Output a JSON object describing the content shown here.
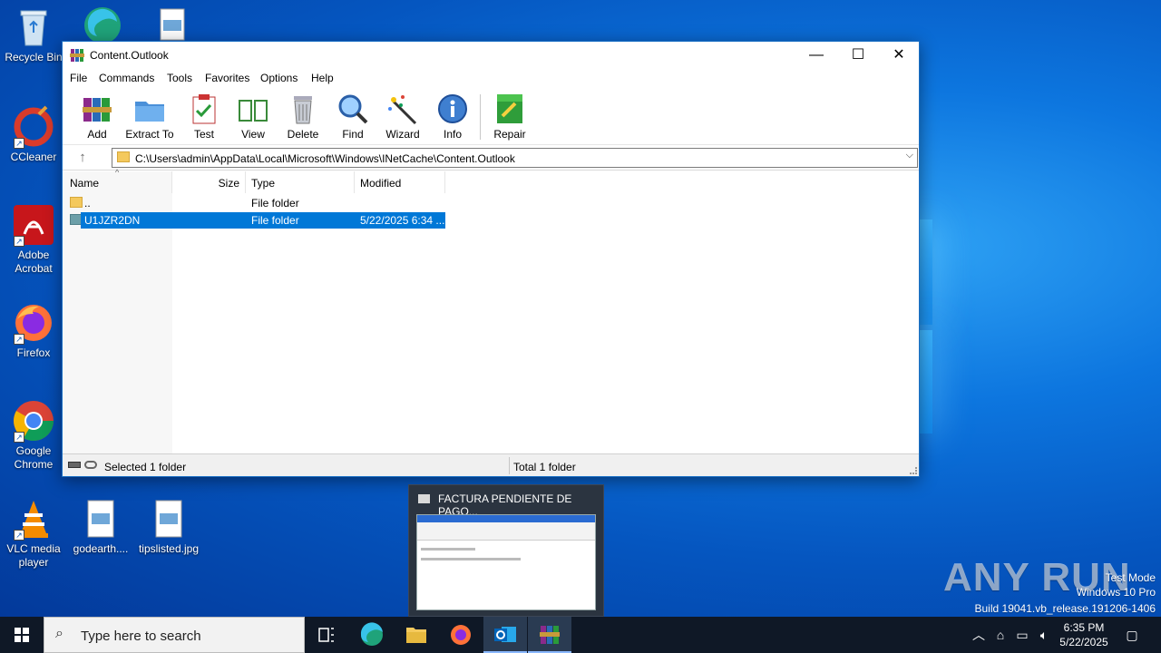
{
  "desktop": {
    "icons": [
      {
        "label": "Recycle Bin",
        "icon": "recycle-bin-icon"
      },
      {
        "label": "CCleaner",
        "icon": "ccleaner-icon"
      },
      {
        "label": "Adobe Acrobat",
        "icon": "adobe-acrobat-icon"
      },
      {
        "label": "Firefox",
        "icon": "firefox-icon"
      },
      {
        "label": "Google Chrome",
        "icon": "chrome-icon"
      },
      {
        "label": "VLC media player",
        "icon": "vlc-icon"
      },
      {
        "label": "godearth....",
        "icon": "image-file-icon"
      },
      {
        "label": "tipslisted.jpg",
        "icon": "image-file-icon"
      }
    ],
    "watermark": {
      "logo": "ANY RUN",
      "line1": "Test Mode",
      "line2": "Windows 10 Pro",
      "line3": "Build 19041.vb_release.191206-1406"
    }
  },
  "window": {
    "title": "Content.Outlook",
    "controls": {
      "minimize": "—",
      "maximize": "☐",
      "close": "✕"
    },
    "menu": [
      "File",
      "Commands",
      "Tools",
      "Favorites",
      "Options",
      "Help"
    ],
    "toolbar": [
      "Add",
      "Extract To",
      "Test",
      "View",
      "Delete",
      "Find",
      "Wizard",
      "Info",
      "Repair"
    ],
    "address": "C:\\Users\\admin\\AppData\\Local\\Microsoft\\Windows\\INetCache\\Content.Outlook",
    "columns": {
      "name": "Name",
      "size": "Size",
      "type": "Type",
      "modified": "Modified"
    },
    "rows": [
      {
        "name": "..",
        "size": "",
        "type": "File folder",
        "modified": "",
        "selected": false
      },
      {
        "name": "U1JZR2DN",
        "size": "",
        "type": "File folder",
        "modified": "5/22/2025 6:34 ...",
        "selected": true
      }
    ],
    "status": {
      "left": "Selected 1 folder",
      "right": "Total 1 folder"
    }
  },
  "preview": {
    "title": "FACTURA PENDIENTE DE PAGO..."
  },
  "taskbar": {
    "search_placeholder": "Type here to search",
    "time": "6:35 PM",
    "date": "5/22/2025"
  },
  "colors": {
    "selection": "#0078d7",
    "taskbar": "#0f1826",
    "desktop": "#0d76df"
  }
}
